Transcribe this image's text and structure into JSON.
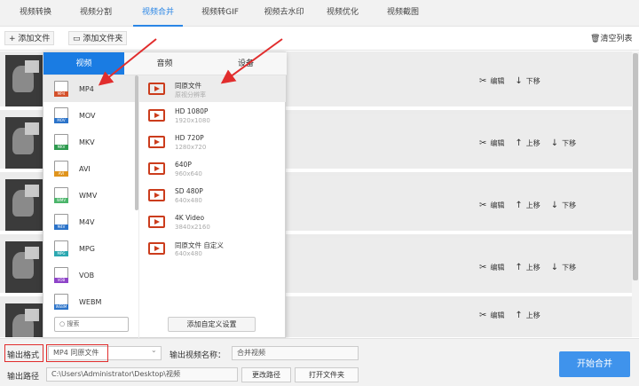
{
  "nav": {
    "tabs": [
      {
        "label": "视频转换"
      },
      {
        "label": "视频分割"
      },
      {
        "label": "视频合并",
        "active": true
      },
      {
        "label": "视频转GIF"
      },
      {
        "label": "视频去水印"
      },
      {
        "label": "视频优化"
      },
      {
        "label": "视频截图"
      }
    ]
  },
  "toolbar": {
    "add_file": "+ 添加文件",
    "add_folder": "添加文件夹",
    "clear_list": "清空列表"
  },
  "filelist": {
    "edit_label": "编辑",
    "up_label": "上移",
    "down_label": "下移"
  },
  "popup": {
    "tabs": [
      "视频",
      "音频",
      "设备"
    ],
    "active_tab": "视频",
    "formats": [
      {
        "name": "MP4",
        "color": "#d4502a"
      },
      {
        "name": "MOV",
        "color": "#2b73c9"
      },
      {
        "name": "MKV",
        "color": "#2e9a4f"
      },
      {
        "name": "AVI",
        "color": "#e0941c"
      },
      {
        "name": "WMV",
        "color": "#4bb56a"
      },
      {
        "name": "M4V",
        "color": "#2b73c9"
      },
      {
        "name": "MPG",
        "color": "#2aa7b0"
      },
      {
        "name": "VOB",
        "color": "#8e44c8"
      },
      {
        "name": "WEBM",
        "color": "#2b73c9"
      }
    ],
    "selected_format": "MP4",
    "search_placeholder": "搜索",
    "options": [
      {
        "title": "同原文件",
        "sub": "原视分辨率"
      },
      {
        "title": "HD 1080P",
        "sub": "1920x1080"
      },
      {
        "title": "HD 720P",
        "sub": "1280x720"
      },
      {
        "title": "640P",
        "sub": "960x640"
      },
      {
        "title": "SD 480P",
        "sub": "640x480"
      },
      {
        "title": "4K Video",
        "sub": "3840x2160"
      },
      {
        "title": "同原文件 自定义",
        "sub": "640x480"
      }
    ],
    "custom_button": "添加自定义设置"
  },
  "bottom": {
    "output_format_label": "输出格式",
    "output_format_value": "MP4  同原文件",
    "output_name_label": "输出视频名称：",
    "output_name_value": "合并视频",
    "output_path_label": "输出路径",
    "output_path_value": "C:\\Users\\Administrator\\Desktop\\视频",
    "change_path": "更改路径",
    "open_folder": "打开文件夹",
    "merge_button": "开始合并"
  },
  "colors": {
    "accent": "#1a7ce3",
    "annotation": "#e12d2d",
    "icon_red": "#cb3c1c"
  },
  "icons": {
    "edit": "scissors-icon",
    "up": "arrow-up-icon",
    "down": "arrow-down-icon",
    "clear": "trash-icon",
    "folder": "folder-icon",
    "play": "video-file-icon"
  }
}
